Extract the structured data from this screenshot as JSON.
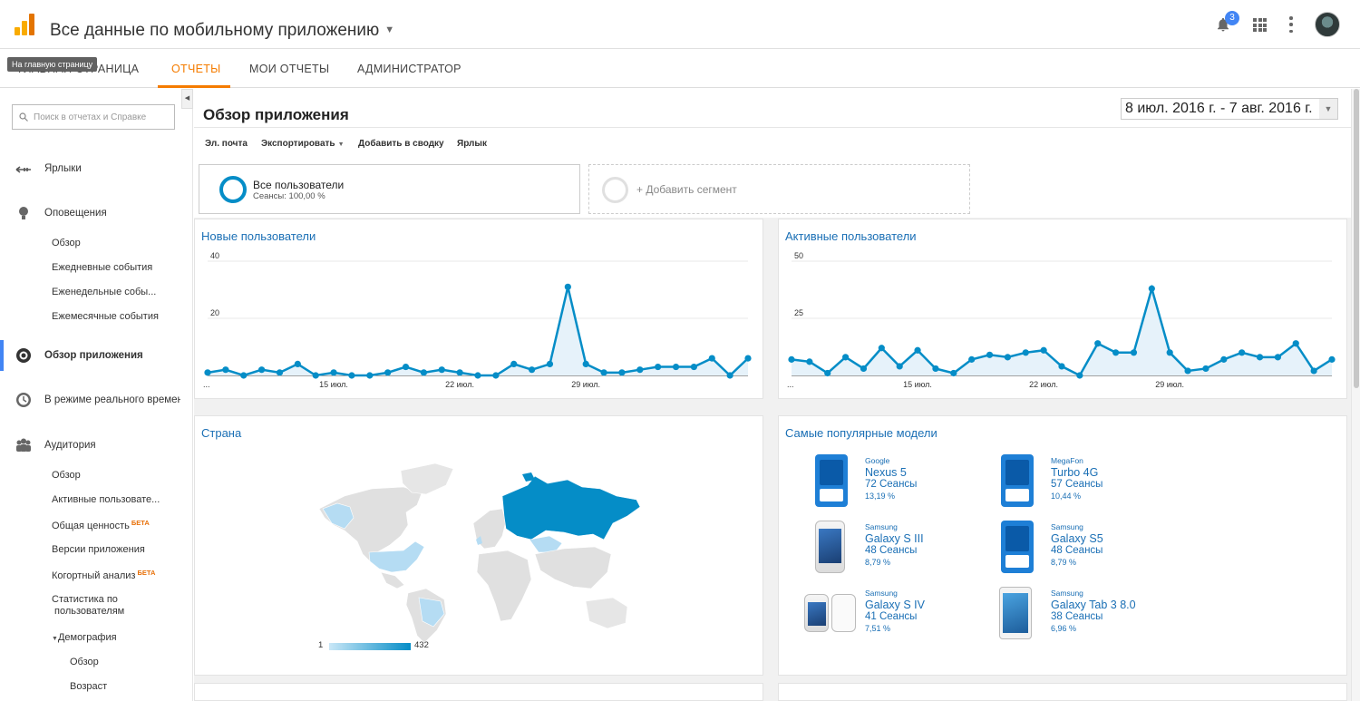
{
  "header": {
    "title": "Все данные по мобильному приложению",
    "notifications_count": "3",
    "icons": [
      "analytics-logo-icon",
      "caret-down-icon",
      "bell-icon",
      "apps-grid-icon",
      "more-vert-icon",
      "avatar"
    ]
  },
  "nav": {
    "tabs": [
      {
        "label": "ГЛАВНАЯ СТРАНИЦА"
      },
      {
        "label": "ОТЧЕТЫ",
        "active": true
      },
      {
        "label": "МОИ ОТЧЕТЫ"
      },
      {
        "label": "АДМИНИСТРАТОР"
      }
    ],
    "tooltip": "На главную страницу"
  },
  "sidebar": {
    "search_placeholder": "Поиск в отчетах и Справке",
    "items": [
      {
        "label": "Ярлыки",
        "icon": "shortcut-arrows-icon"
      },
      {
        "label": "Оповещения",
        "icon": "lightbulb-icon"
      },
      {
        "label": "Обзор приложения",
        "icon": "record-icon",
        "active": true
      },
      {
        "label": "В режиме реального времени",
        "icon": "clock-icon"
      },
      {
        "label": "Аудитория",
        "icon": "people-icon"
      }
    ],
    "alerts_sub": [
      "Обзор",
      "Ежедневные события",
      "Еженедельные собы...",
      "Ежемесячные события"
    ],
    "audience_sub": [
      "Обзор",
      "Активные пользовате...",
      "Общая ценность",
      "Версии приложения",
      "Когортный анализ",
      "Статистика по",
      "пользователям",
      "Демография"
    ],
    "beta_label": "БЕТА",
    "demography_sub": [
      "Обзор",
      "Возраст"
    ],
    "colors": {
      "active": "#4285f4",
      "beta": "#e8710a"
    }
  },
  "main": {
    "page_title": "Обзор приложения",
    "date_range": "8 июл. 2016 г. - 7 авг. 2016 г.",
    "toolbar": [
      "Эл. почта",
      "Экспортировать",
      "Добавить в сводку",
      "Ярлык"
    ],
    "segment": {
      "name": "Все пользователи",
      "sub": "Сеансы: 100,00 %"
    },
    "add_segment": "+ Добавить сегмент",
    "panels": {
      "new_users": "Новые пользователи",
      "active_users": "Активные пользователи",
      "country": "Страна",
      "popular_models": "Самые популярные модели"
    }
  },
  "map": {
    "legend_min": "1",
    "legend_max": "432",
    "accent": "#058dc7"
  },
  "models": [
    {
      "brand": "Google",
      "name": "Nexus 5",
      "sessions": "72 Сеансы",
      "pct": "13,19 %",
      "img": "phone-generic-icon"
    },
    {
      "brand": "MegaFon",
      "name": "Turbo 4G",
      "sessions": "57 Сеансы",
      "pct": "10,44 %",
      "img": "phone-generic-icon"
    },
    {
      "brand": "Samsung",
      "name": "Galaxy S III",
      "sessions": "48 Сеансы",
      "pct": "8,79 %",
      "img": "phone-photo"
    },
    {
      "brand": "Samsung",
      "name": "Galaxy S5",
      "sessions": "48 Сеансы",
      "pct": "8,79 %",
      "img": "phone-generic-icon"
    },
    {
      "brand": "Samsung",
      "name": "Galaxy S IV",
      "sessions": "41 Сеансы",
      "pct": "7,51 %",
      "img": "phone-photo"
    },
    {
      "brand": "Samsung",
      "name": "Galaxy Tab 3 8.0",
      "sessions": "38 Сеансы",
      "pct": "6,96 %",
      "img": "tablet-photo"
    }
  ],
  "chart_data": [
    {
      "type": "area",
      "title": "Новые пользователи",
      "x_ticks": [
        "...",
        "15 июл.",
        "22 июл.",
        "29 июл."
      ],
      "y_ticks": [
        20,
        40
      ],
      "ylim": [
        0,
        40
      ],
      "color": "#058dc7",
      "values": [
        1,
        2,
        0,
        2,
        1,
        4,
        0,
        1,
        0,
        0,
        1,
        3,
        1,
        2,
        1,
        0,
        0,
        4,
        2,
        4,
        31,
        4,
        1,
        1,
        2,
        3,
        3,
        3,
        6,
        0,
        6
      ]
    },
    {
      "type": "area",
      "title": "Активные пользователи",
      "x_ticks": [
        "...",
        "15 июл.",
        "22 июл.",
        "29 июл."
      ],
      "y_ticks": [
        25,
        50
      ],
      "ylim": [
        0,
        50
      ],
      "color": "#058dc7",
      "values": [
        7,
        6,
        1,
        8,
        3,
        12,
        4,
        11,
        3,
        1,
        7,
        9,
        8,
        10,
        11,
        4,
        0,
        14,
        10,
        10,
        38,
        10,
        2,
        3,
        7,
        10,
        8,
        8,
        14,
        2,
        7
      ]
    }
  ]
}
